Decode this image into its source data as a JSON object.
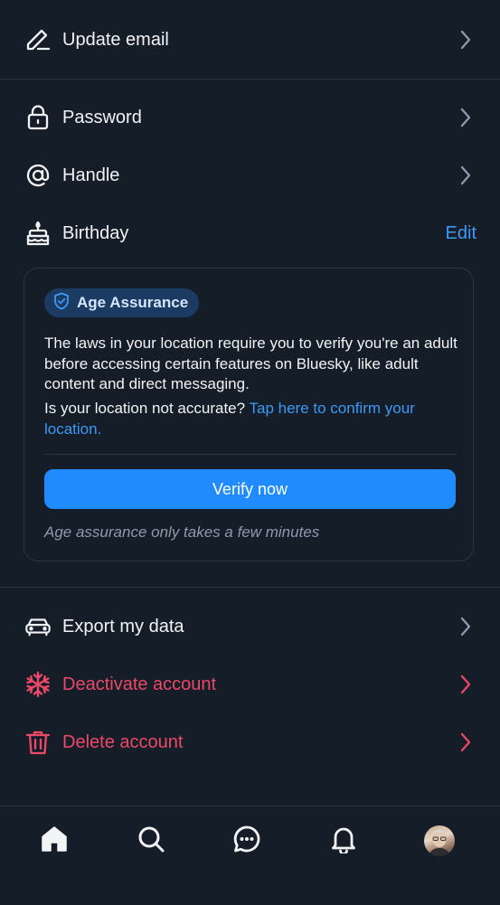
{
  "settings": {
    "update_email": "Update email",
    "password": "Password",
    "handle": "Handle",
    "birthday": "Birthday",
    "birthday_action": "Edit",
    "export_data": "Export my data",
    "deactivate": "Deactivate account",
    "delete": "Delete account"
  },
  "age_assurance": {
    "badge": "Age Assurance",
    "body": "The laws in your location require you to verify you're an adult before accessing certain features on Bluesky, like adult content and direct messaging.",
    "location_question": "Is your location not accurate?",
    "location_link": "Tap here to confirm your location.",
    "verify_button": "Verify now",
    "note": "Age assurance only takes a few minutes"
  },
  "tabbar": {
    "items": [
      "home-icon",
      "search-icon",
      "chat-icon",
      "bell-icon",
      "avatar"
    ]
  },
  "colors": {
    "background": "#151d28",
    "accent": "#208bfe",
    "link": "#3b9af6",
    "danger": "#ec4868",
    "muted": "#8d9bad"
  }
}
